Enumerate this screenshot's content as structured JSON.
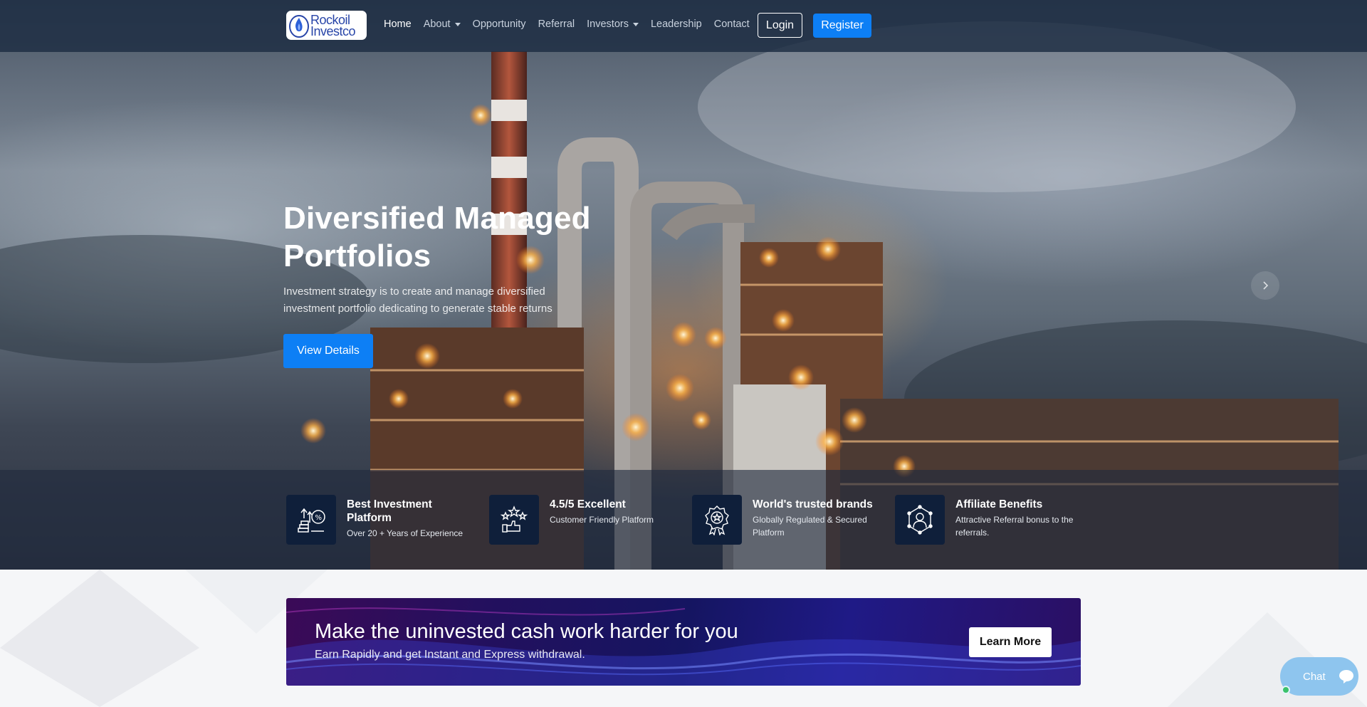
{
  "nav": {
    "logo_line1": "Rockoil",
    "logo_line2": "Investco",
    "items": [
      {
        "label": "Home",
        "active": true,
        "dropdown": false
      },
      {
        "label": "About",
        "active": false,
        "dropdown": true
      },
      {
        "label": "Opportunity",
        "active": false,
        "dropdown": false
      },
      {
        "label": "Referral",
        "active": false,
        "dropdown": false
      },
      {
        "label": "Investors",
        "active": false,
        "dropdown": true
      },
      {
        "label": "Leadership",
        "active": false,
        "dropdown": false
      },
      {
        "label": "Contact",
        "active": false,
        "dropdown": false
      }
    ],
    "login_label": "Login",
    "register_label": "Register"
  },
  "hero": {
    "title": "Diversified Managed Portfolios",
    "subtitle": "Investment strategy is to create and manage diversified investment portfolio dedicating to generate stable returns",
    "cta_label": "View Details",
    "next_icon": "chevron-right-icon"
  },
  "features": [
    {
      "icon": "investment-growth-icon",
      "title": "Best Investment Platform",
      "desc": "Over 20 + Years of Experience"
    },
    {
      "icon": "rating-stars-icon",
      "title": "4.5/5 Excellent",
      "desc": "Customer Friendly Platform"
    },
    {
      "icon": "award-badge-icon",
      "title": "World's trusted brands",
      "desc": "Globally Regulated & Secured Platform"
    },
    {
      "icon": "affiliate-network-icon",
      "title": "Affiliate Benefits",
      "desc": "Attractive Referral bonus to the referrals."
    }
  ],
  "promo": {
    "title": "Make the uninvested cash work harder for you",
    "subtitle": "Earn Rapidly and get Instant and Express withdrawal.",
    "cta_label": "Learn More"
  },
  "chat": {
    "label": "Chat",
    "icon": "chat-bubble-icon",
    "status_color": "#3bc26b"
  },
  "colors": {
    "primary": "#0d7ff5",
    "nav_bg": "#1c2c42",
    "feature_icon_bg": "#0f1f3a"
  }
}
